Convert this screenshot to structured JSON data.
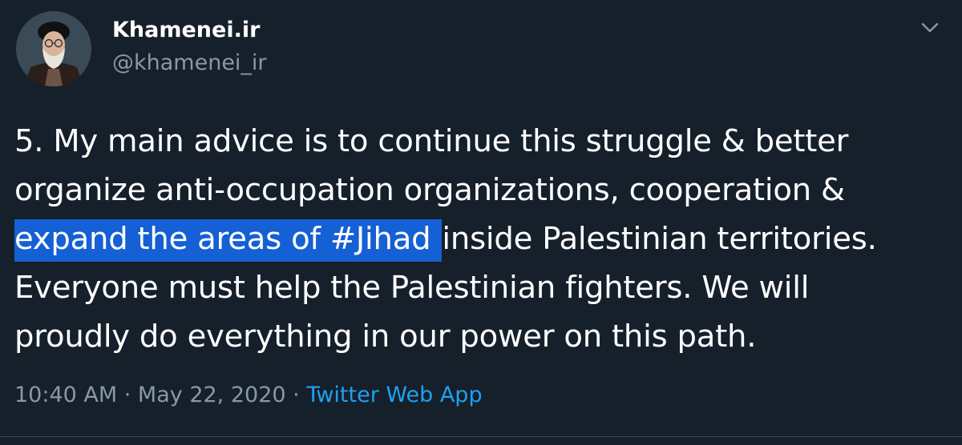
{
  "user": {
    "display_name": "Khamenei.ir",
    "handle": "@khamenei_ir"
  },
  "tweet": {
    "line1": "5. My main advice is to continue this struggle & better",
    "line2": "organize anti-occupation organizations, cooperation &",
    "line3_highlight": "expand the areas of #Jihad",
    "line3_rest": "inside Palestinian territories.",
    "line4": "Everyone must help the Palestinian fighters. We will",
    "line5": "proudly do everything in our power on this path."
  },
  "meta": {
    "time": "10:40 AM",
    "separator1": " · ",
    "date": "May 22, 2020",
    "separator2": " · ",
    "source": "Twitter Web App"
  },
  "colors": {
    "background": "#15202b",
    "secondary_text": "#8899a6",
    "accent": "#1da1f2",
    "selection": "#1560d4"
  },
  "icons": {
    "menu": "chevron-down-icon",
    "avatar": "avatar"
  }
}
